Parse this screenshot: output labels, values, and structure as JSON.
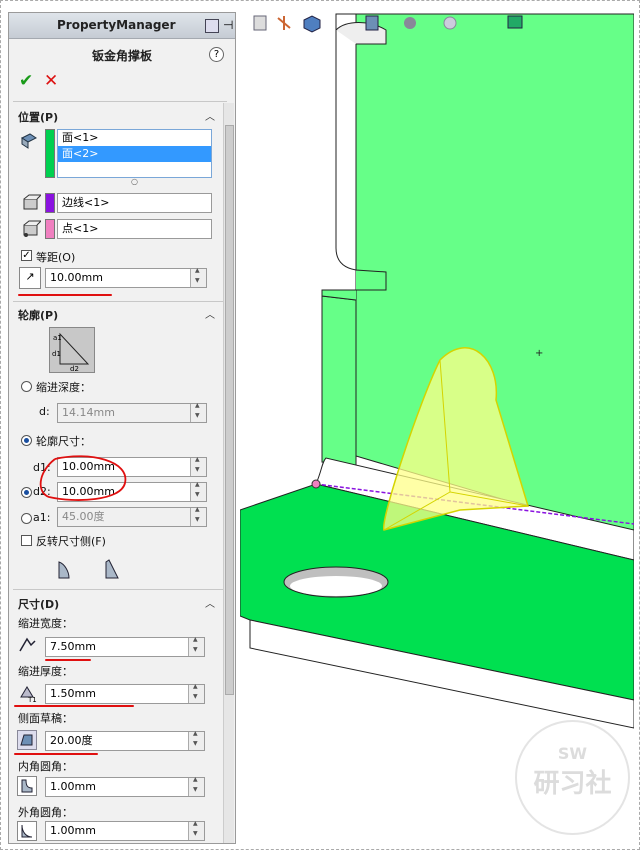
{
  "header": {
    "title": "PropertyManager"
  },
  "feature": {
    "title": "钣金角撑板",
    "help": "?",
    "ok": "✔",
    "cancel": "✕"
  },
  "position": {
    "label": "位置(P)",
    "faces": [
      "面<1>",
      "面<2>"
    ],
    "edge": "边线<1>",
    "point": "点<1>",
    "equal_label": "等距(O)",
    "offset_value": "10.00mm"
  },
  "profile": {
    "label": "轮廓(P)",
    "indent_depth_label": "缩进深度：",
    "d_label": "d:",
    "d_value": "14.14mm",
    "profile_dims_label": "轮廓尺寸：",
    "d1_label": "d1:",
    "d1_value": "10.00mm",
    "d2_label": "d2:",
    "d2_value": "10.00mm",
    "a1_label": "a1:",
    "a1_value": "45.00度",
    "flip_label": "反转尺寸侧(F)"
  },
  "dimensions": {
    "label": "尺寸(D)",
    "indent_width_label": "缩进宽度：",
    "indent_width_value": "7.50mm",
    "indent_thickness_label": "缩进厚度：",
    "indent_thickness_value": "1.50mm",
    "side_draft_label": "侧面草稿：",
    "side_draft_value": "20.00度",
    "inner_fillet_label": "内角圆角：",
    "inner_fillet_value": "1.00mm",
    "outer_fillet_label": "外角圆角：",
    "outer_fillet_value": "1.00mm"
  },
  "watermark": {
    "top": "SW",
    "main": "研习社"
  },
  "colors": {
    "face_green": "#66ff88",
    "bright_green": "#00e050",
    "selection_blue": "#3399ff",
    "annotation_red": "#e01010"
  }
}
